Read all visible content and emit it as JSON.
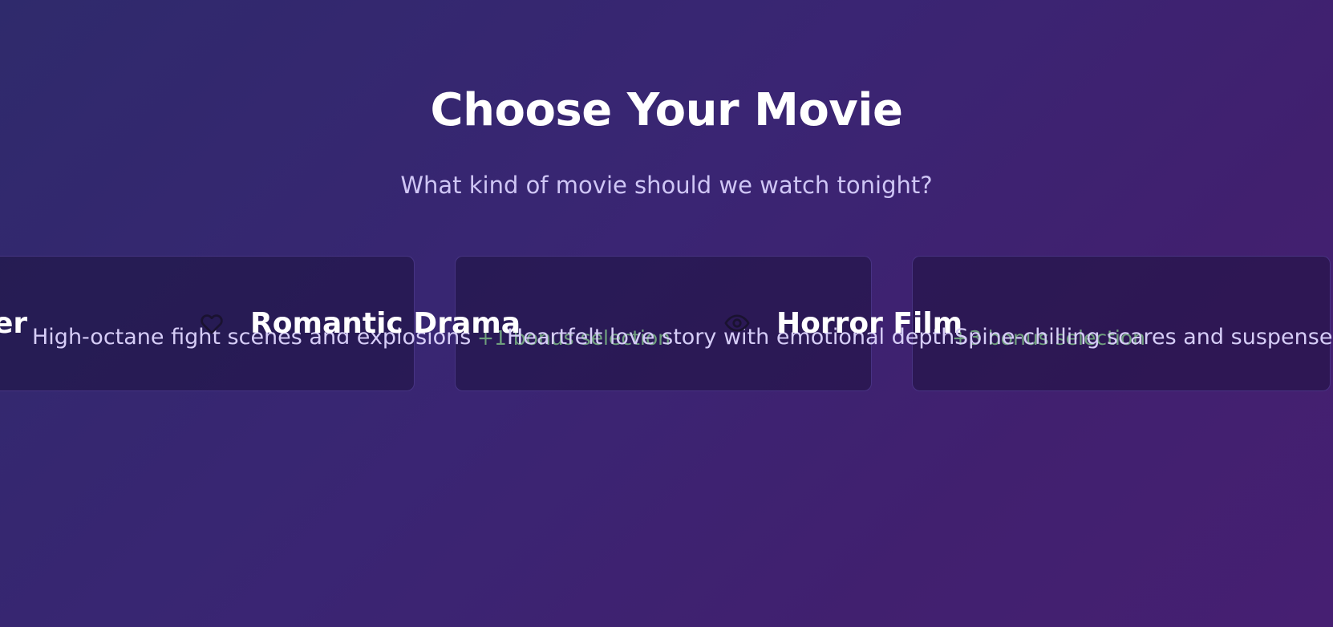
{
  "header": {
    "title": "Choose Your Movie",
    "subtitle": "What kind of movie should we watch tonight?"
  },
  "cards": [
    {
      "title": "er",
      "description": "High-octane fight scenes and explosions",
      "bonus": "+1 bonus selection",
      "icon": "",
      "selected": false
    },
    {
      "title": "Romantic Drama",
      "description": "Heartfelt love story with emotional depth",
      "bonus": "+3 bonus selection",
      "icon": "heart-icon",
      "selected": false
    },
    {
      "title": "Horror Film",
      "description": "Spine-chilling scares and suspense",
      "bonus": "",
      "icon": "eye-icon",
      "selected": false
    }
  ],
  "colors": {
    "background_start": "#2f2a6c",
    "background_end": "#461f72",
    "title": "#ffffff",
    "subtitle": "#cfc6f5",
    "bonus": "#6f9f7d",
    "icon": "#1a1230"
  }
}
